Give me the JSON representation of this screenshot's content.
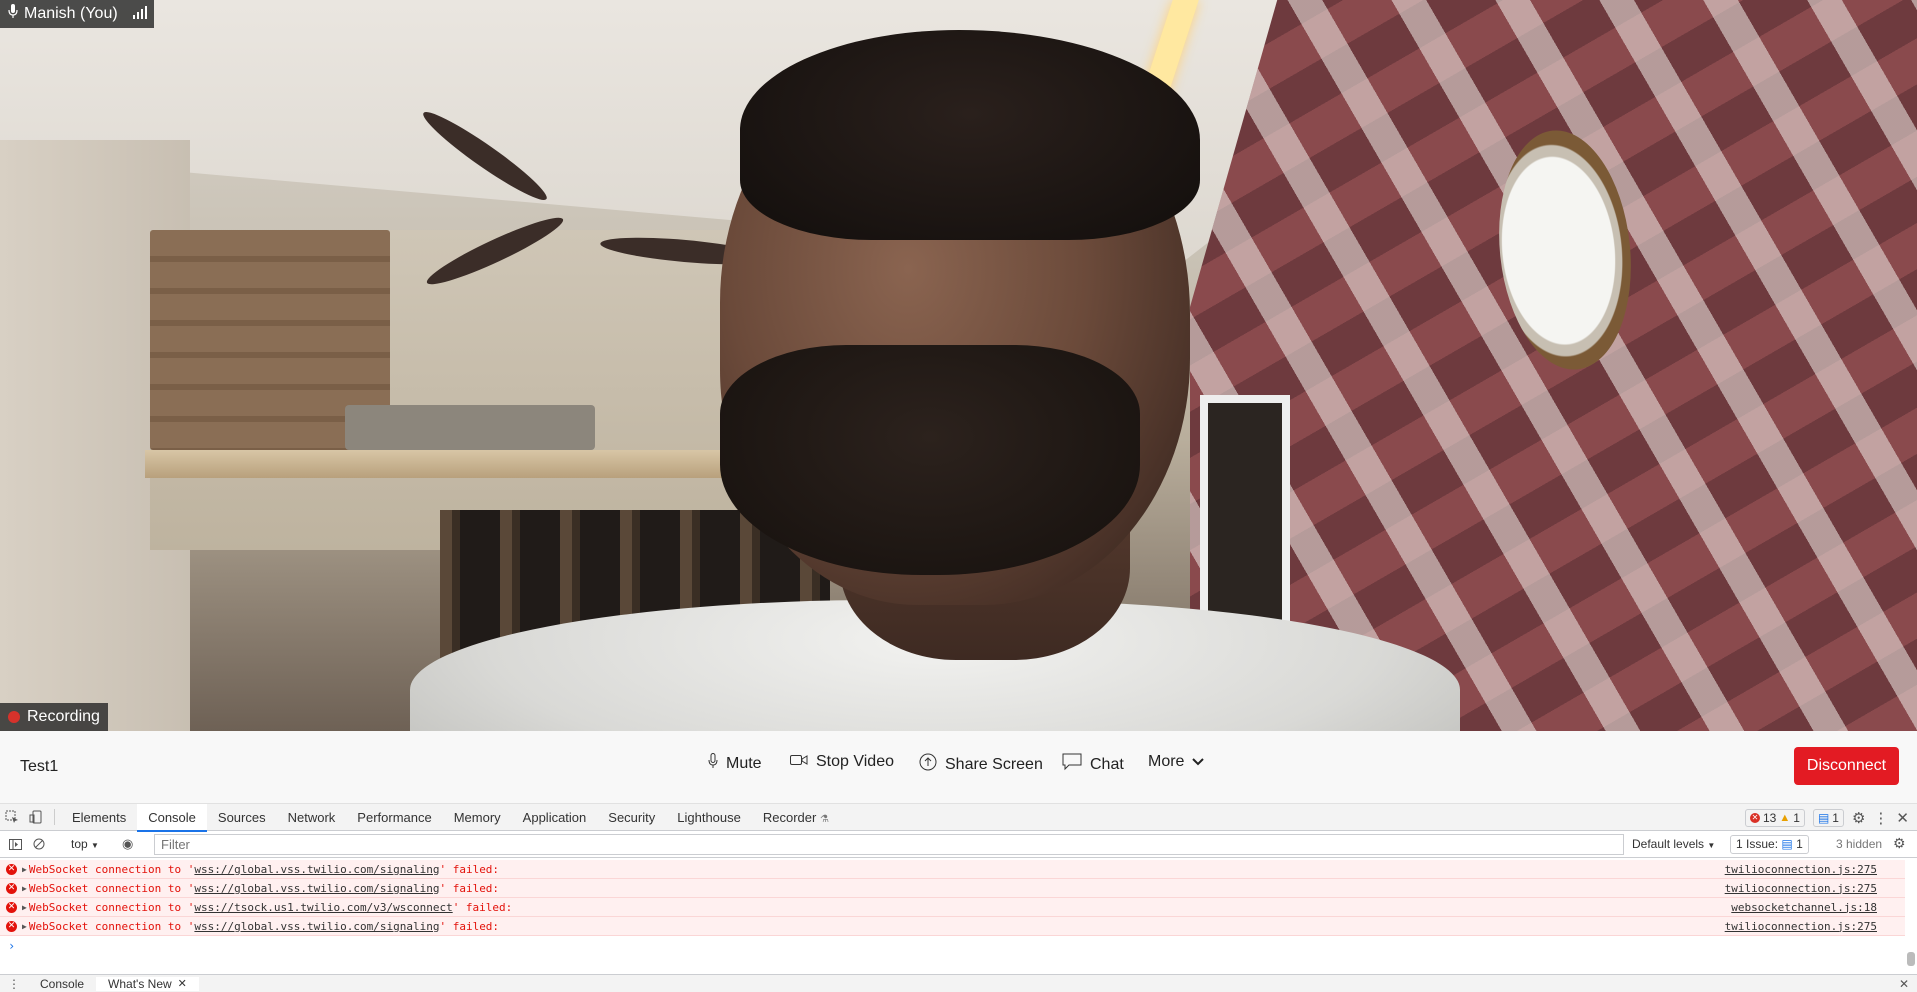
{
  "video": {
    "participant_name": "Manish (You)",
    "recording_label": "Recording"
  },
  "controls": {
    "room_name": "Test1",
    "mute_label": "Mute",
    "stop_video_label": "Stop Video",
    "share_screen_label": "Share Screen",
    "chat_label": "Chat",
    "more_label": "More",
    "disconnect_label": "Disconnect"
  },
  "devtools": {
    "tabs": [
      "Elements",
      "Console",
      "Sources",
      "Network",
      "Performance",
      "Memory",
      "Application",
      "Security",
      "Lighthouse",
      "Recorder"
    ],
    "active_tab": "Console",
    "error_count": "13",
    "warning_count": "1",
    "info_count": "1",
    "toolbar": {
      "context": "top",
      "filter_placeholder": "Filter",
      "levels": "Default levels",
      "issues_label": "1 Issue:",
      "issues_count": "1",
      "hidden": "3 hidden"
    },
    "logs": [
      {
        "prefix": "WebSocket connection to '",
        "url": "wss://global.vss.twilio.com/signaling",
        "suffix": "' failed:",
        "source": "twilioconnection.js:275"
      },
      {
        "prefix": "WebSocket connection to '",
        "url": "wss://global.vss.twilio.com/signaling",
        "suffix": "' failed:",
        "source": "twilioconnection.js:275"
      },
      {
        "prefix": "WebSocket connection to '",
        "url": "wss://tsock.us1.twilio.com/v3/wsconnect",
        "suffix": "' failed:",
        "source": "websocketchannel.js:18"
      },
      {
        "prefix": "WebSocket connection to '",
        "url": "wss://global.vss.twilio.com/signaling",
        "suffix": "' failed:",
        "source": "twilioconnection.js:275"
      }
    ],
    "drawer": {
      "console_tab": "Console",
      "whats_new_tab": "What's New"
    }
  },
  "colors": {
    "disconnect": "#e31b23",
    "devtools_accent": "#1a73e8",
    "error": "#e3120b"
  }
}
